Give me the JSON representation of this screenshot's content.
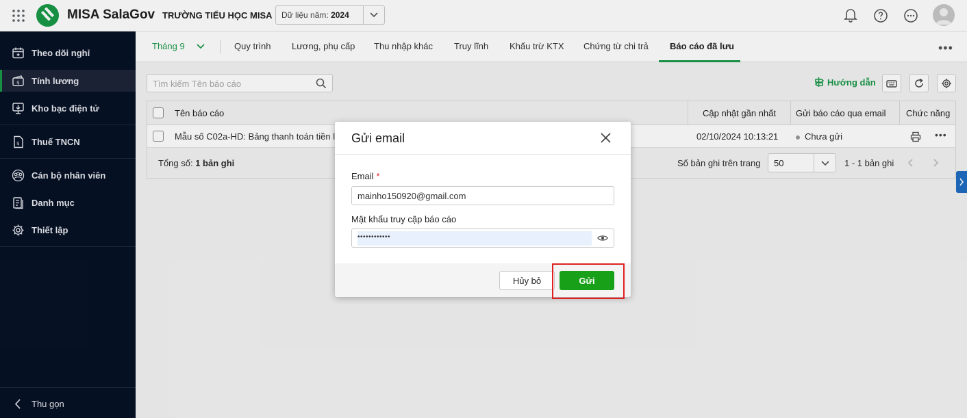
{
  "header": {
    "app_name": "MISA SalaGov",
    "school": "TRƯỜNG TIỂU HỌC MISA",
    "year_label": "Dữ liệu năm:",
    "year_value": "2024"
  },
  "sidebar": {
    "items": [
      {
        "label": "Theo dõi nghỉ",
        "icon": "calendar-icon"
      },
      {
        "label": "Tính lương",
        "icon": "salary-icon",
        "active": true
      },
      {
        "label": "Kho bạc điện tử",
        "icon": "treasury-icon"
      },
      {
        "label": "Thuế TNCN",
        "icon": "tax-document-icon"
      },
      {
        "label": "Cán bộ nhân viên",
        "icon": "staff-icon"
      },
      {
        "label": "Danh mục",
        "icon": "catalog-icon"
      },
      {
        "label": "Thiết lập",
        "icon": "gear-icon"
      }
    ],
    "collapse_label": "Thu gọn"
  },
  "tabs": {
    "month": "Tháng 9",
    "items": [
      "Quy trình",
      "Lương, phụ cấp",
      "Thu nhập khác",
      "Truy lĩnh",
      "Khấu trừ KTX",
      "Chứng từ chi trả",
      "Báo cáo đã lưu"
    ],
    "active": "Báo cáo đã lưu"
  },
  "toolbar": {
    "search_placeholder": "Tìm kiếm Tên báo cáo",
    "guide_label": "Hướng dẫn"
  },
  "table": {
    "columns": [
      "Tên báo cáo",
      "Cập nhật gần nhất",
      "Gửi báo cáo qua email",
      "Chức năng"
    ],
    "rows": [
      {
        "name": "Mẫu số C02a-HD: Bảng thanh toán tiền lư",
        "updated": "02/10/2024 10:13:21",
        "email_status": "Chưa gửi"
      }
    ],
    "total_label": "Tổng số:",
    "total_value": "1 bản ghi",
    "per_page_label": "Số bản ghi trên trang",
    "per_page_value": "50",
    "range": "1 - 1 bản ghi"
  },
  "dialog": {
    "title": "Gửi email",
    "email_label": "Email",
    "required_mark": "*",
    "email_value": "mainho150920@gmail.com",
    "password_label": "Mật khẩu truy cập báo cáo",
    "password_value": "••••••••••••",
    "cancel_label": "Hủy bỏ",
    "send_label": "Gửi"
  },
  "colors": {
    "brand_green": "#1a9a49",
    "send_button": "#18a018",
    "sidebar_bg": "#071226",
    "highlight": "#e02020"
  }
}
